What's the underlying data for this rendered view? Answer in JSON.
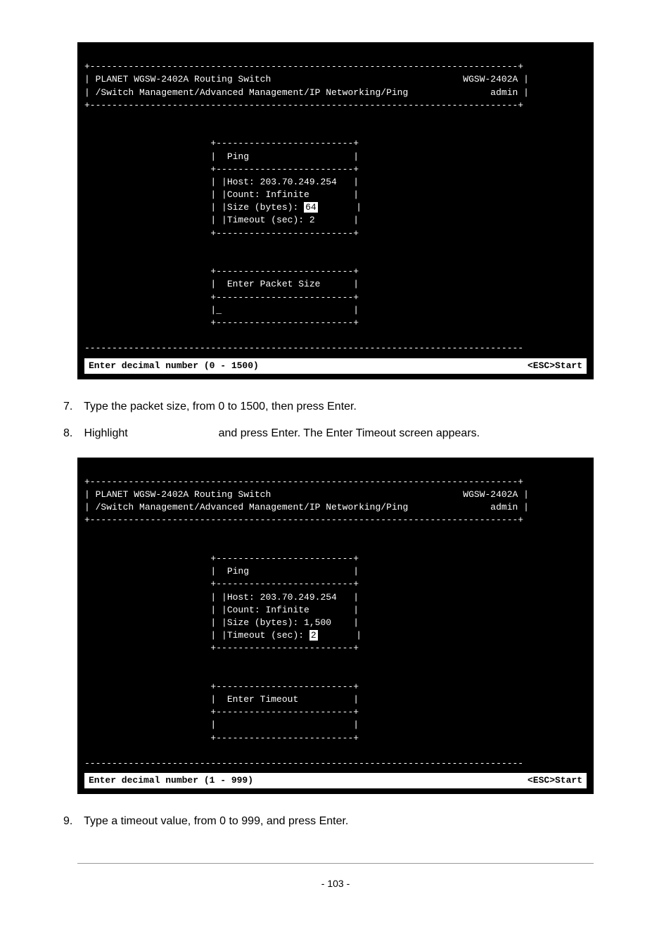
{
  "terminal1": {
    "top_border": "+------------------------------------------------------------------------------+",
    "header_title": "| PLANET WGSW-2402A Routing Switch                                   WGSW-2402A |",
    "breadcrumb": "| /Switch Management/Advanced Management/IP Networking/Ping               admin |",
    "mid_border": "+------------------------------------------------------------------------------+",
    "box_border": "                       +-------------------------+",
    "box_title": "                       |  Ping                   |",
    "host": "                       | |Host: 203.70.249.254   |",
    "count": "                       | |Count: Infinite        |",
    "size_label": "                       | |Size (bytes): ",
    "size_value": "64",
    "size_suffix": "       |",
    "timeout": "                       | |Timeout (sec): 2       |",
    "prompt_title": "                       |  Enter Packet Size      |",
    "input_line": "                       |_                        |",
    "dash_line": "--------------------------------------------------------------------------------",
    "status_left": "Enter decimal number (0 - 1500)",
    "status_right": "<ESC>Start"
  },
  "terminal2": {
    "top_border": "+------------------------------------------------------------------------------+",
    "header_title": "| PLANET WGSW-2402A Routing Switch                                   WGSW-2402A |",
    "breadcrumb": "| /Switch Management/Advanced Management/IP Networking/Ping               admin |",
    "mid_border": "+------------------------------------------------------------------------------+",
    "box_border": "                       +-------------------------+",
    "box_title": "                       |  Ping                   |",
    "host": "                       | |Host: 203.70.249.254   |",
    "count": "                       | |Count: Infinite        |",
    "size": "                       | |Size (bytes): 1,500    |",
    "timeout_label": "                       | |Timeout (sec): ",
    "timeout_value": "2",
    "timeout_suffix": "       |",
    "prompt_title": "                       |  Enter Timeout          |",
    "input_line": "                       |                         |",
    "dash_line": "--------------------------------------------------------------------------------",
    "status_left": "Enter decimal number (1 - 999)",
    "status_right": "<ESC>Start"
  },
  "instruction7": "Type the packet size, from 0 to 1500, then press Enter.",
  "instruction8_prefix": "Highlight",
  "instruction8_suffix": "and press Enter. The Enter Timeout screen appears.",
  "instruction9": "Type a timeout value, from 0 to 999, and press Enter.",
  "page_number": "- 103 -"
}
